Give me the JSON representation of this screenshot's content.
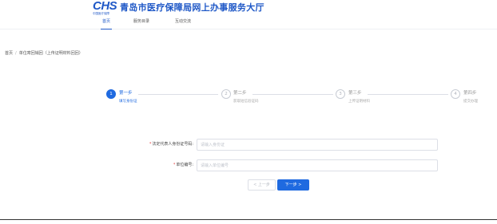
{
  "header": {
    "logo_text": "CHS",
    "logo_sub": "中国医疗保障",
    "title": "青岛市医疗保障局网上办事服务大厅",
    "nav": [
      {
        "label": "首页",
        "active": true
      },
      {
        "label": "服务目录",
        "active": false
      },
      {
        "label": "互动交流",
        "active": false
      }
    ]
  },
  "breadcrumb": {
    "home": "首页",
    "separator": "/",
    "current": "单位寄回销回（上传证明材料回回）"
  },
  "steps": [
    {
      "number": "1",
      "title": "第一步",
      "desc": "填写身份证",
      "active": true
    },
    {
      "number": "2",
      "title": "第二步",
      "desc": "获取短信验证码",
      "active": false
    },
    {
      "number": "3",
      "title": "第三步",
      "desc": "上传证明材料",
      "active": false
    },
    {
      "number": "4",
      "title": "第四步",
      "desc": "提交办理",
      "active": false
    }
  ],
  "form": {
    "id_label": "法定代表人身份证号码:",
    "id_placeholder": "请输入身份证",
    "id_value": "",
    "unit_label": "单位编号:",
    "unit_placeholder": "请输入单位编号",
    "unit_value": "",
    "required_mark": "*"
  },
  "buttons": {
    "prev": "< 上一步",
    "next": "下一步 >"
  },
  "colors": {
    "brand": "#1f58c7",
    "accent": "#1f6ae0",
    "required": "#e54545"
  }
}
